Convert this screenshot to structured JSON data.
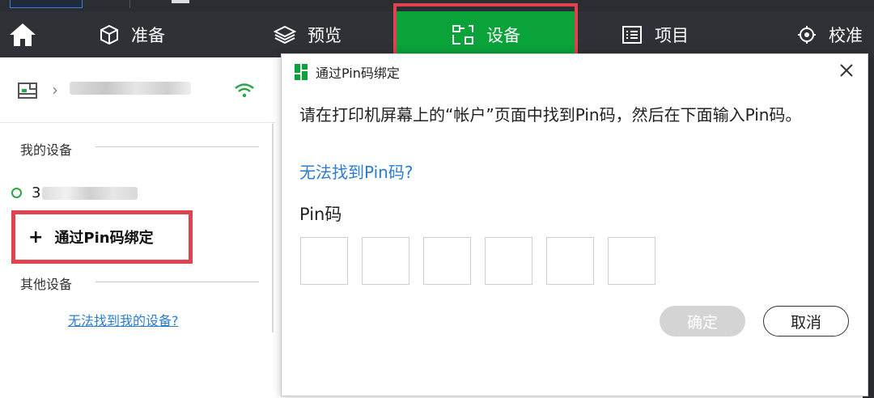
{
  "nav": {
    "items": [
      {
        "label": "准备",
        "icon": "cube-icon"
      },
      {
        "label": "预览",
        "icon": "layers-icon"
      },
      {
        "label": "设备",
        "icon": "device-icon",
        "active": true
      },
      {
        "label": "项目",
        "icon": "list-icon"
      },
      {
        "label": "校准",
        "icon": "calibrate-icon"
      }
    ]
  },
  "sidebar": {
    "my_devices": "我的设备",
    "device_prefix": "3",
    "add_bind": "通过Pin码绑定",
    "other_devices": "其他设备",
    "help_link": "无法找到我的设备?"
  },
  "dialog": {
    "title": "通过Pin码绑定",
    "instruction": "请在打印机屏幕上的“帐户”页面中找到Pin码，然后在下面输入Pin码。",
    "cant_find": "无法找到Pin码?",
    "pin_label": "Pin码",
    "ok_label": "确定",
    "cancel_label": "取消"
  },
  "colors": {
    "accent_green": "#0aa33a",
    "highlight_red": "#e04350",
    "link_blue": "#2b7cd3"
  }
}
